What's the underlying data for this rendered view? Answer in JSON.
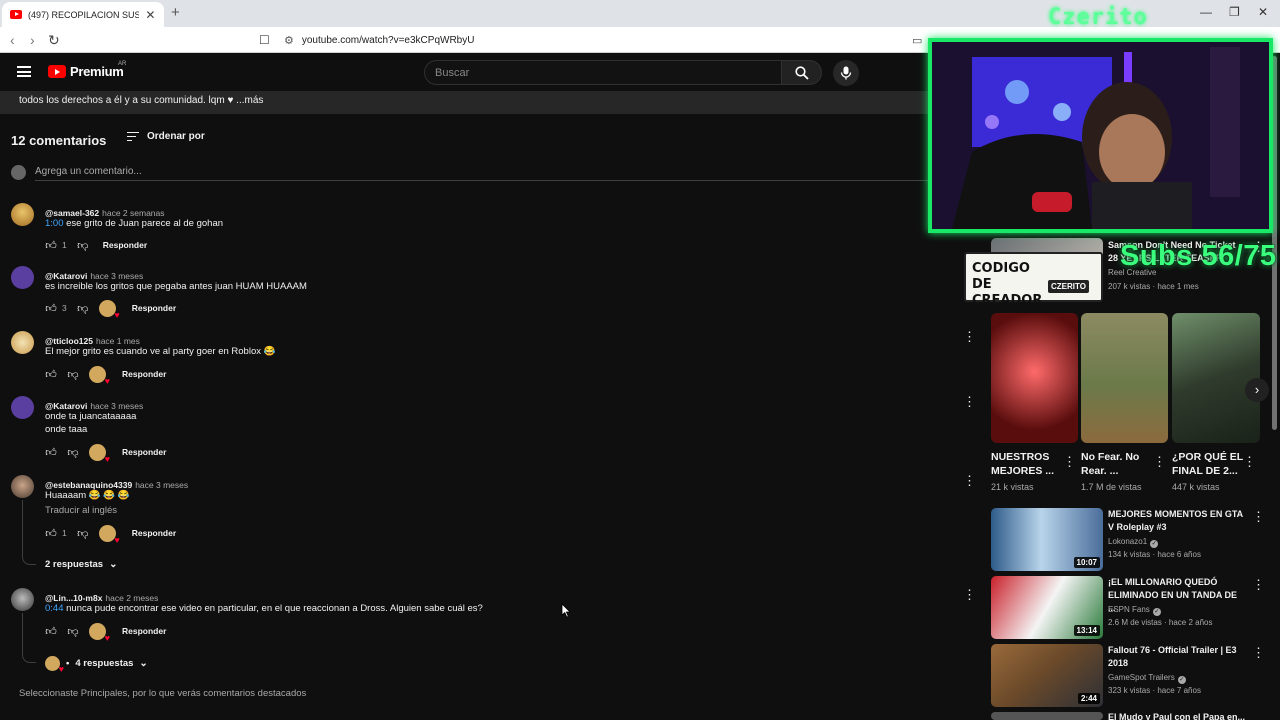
{
  "browser": {
    "tab_title": "(497) RECOPILACION SUSTOS D",
    "url": "youtube.com/watch?v=e3kCPqWRbyU"
  },
  "header": {
    "logo_text": "Premium",
    "region": "AR",
    "search_placeholder": "Buscar"
  },
  "description_tail": "todos los derechos a él y a su comunidad. lqm ♥  ...más",
  "comments": {
    "count_label": "12 comentarios",
    "sort_label": "Ordenar por",
    "add_placeholder": "Agrega un comentario...",
    "reply_label": "Responder",
    "items": [
      {
        "author": "@samael-362",
        "time": "hace 2 semanas",
        "timestamp": "1:00",
        "text": " ese grito de Juan parece al de gohan",
        "likes": "1",
        "creator_heart": false
      },
      {
        "author": "@Katarovi",
        "time": "hace 3 meses",
        "text": "es increible los gritos que pegaba antes juan HUAM HUAAAM",
        "likes": "3",
        "creator_heart": true
      },
      {
        "author": "@tticloo125",
        "time": "hace 1 mes",
        "text": "El mejor grito es cuando ve al party goer en Roblox 😂",
        "likes": "",
        "creator_heart": true
      },
      {
        "author": "@Katarovi",
        "time": "hace 3 meses",
        "text_line1": "onde ta juancataaaaa",
        "text_line2": "onde taaa",
        "likes": "",
        "creator_heart": true
      },
      {
        "author": "@estebanaquino4339",
        "time": "hace 3 meses",
        "text": "Huaaaam 😂 😂 😂",
        "translate": "Traducir al inglés",
        "likes": "1",
        "creator_heart": true,
        "replies": "2 respuestas"
      },
      {
        "author": "@Lin...10-m8x",
        "time": "hace 2 meses",
        "timestamp": "0:44",
        "text": " nunca pude encontrar ese video en particular, en el que reaccionan a Dross. Alguien sabe cuál es?",
        "likes": "",
        "creator_heart": true,
        "replies": "4 respuestas"
      }
    ],
    "footnote": "Seleccionaste Principales, por lo que verás comentarios destacados"
  },
  "sidebar": {
    "top_video": {
      "title": "Samson Don't Need No Ticket 28 YEARS LATER TEASER",
      "channel": "Reel Creative",
      "stats": "207 k vistas · hace 1 mes"
    },
    "shorts": [
      {
        "title": "NUESTROS MEJORES ...",
        "views": "21 k vistas"
      },
      {
        "title": "No Fear. No Rear. ...",
        "views": "1.7 M de vistas"
      },
      {
        "title": "¿POR QUÉ EL FINAL DE 2...",
        "views": "447 k vistas"
      }
    ],
    "videos": [
      {
        "title": "MEJORES MOMENTOS EN GTA V Roleplay #3",
        "channel": "Lokonazo1",
        "stats": "134 k vistas · hace 6 años",
        "duration": "10:07"
      },
      {
        "title": "¡EL MILLONARIO QUEDÓ ELIMINADO EN UN TANDA DE ...",
        "channel": "ESPN Fans",
        "stats": "2.6 M de vistas · hace 2 años",
        "duration": "13:14"
      },
      {
        "title": "Fallout 76 - Official Trailer | E3 2018",
        "channel": "GameSpot Trailers",
        "stats": "323 k vistas · hace 7 años",
        "duration": "2:44"
      },
      {
        "title": "El Mudo y Paul con el Papa en..."
      }
    ]
  },
  "overlays": {
    "streamer_name": "Czerito",
    "subs_counter": "Subs 56/75",
    "creator_code": "CODIGO DE CREADOR",
    "creator_badge": "CZERITO"
  }
}
